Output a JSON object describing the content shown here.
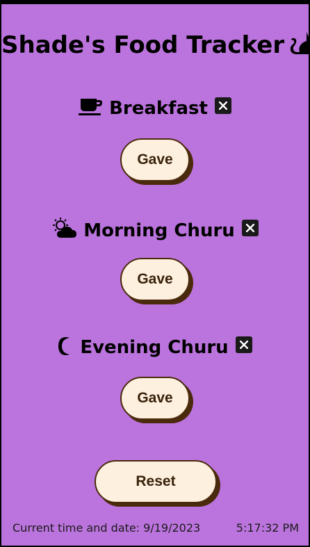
{
  "app": {
    "title": "Shade's Food Tracker"
  },
  "meals": [
    {
      "label": "Breakfast",
      "icon": "coffee-icon",
      "button_label": "Gave"
    },
    {
      "label": "Morning Churu",
      "icon": "sun-behind-cloud-icon",
      "button_label": "Gave"
    },
    {
      "label": "Evening Churu",
      "icon": "moon-icon",
      "button_label": "Gave"
    }
  ],
  "reset_label": "Reset",
  "footer": {
    "date_text": "Current time and date: 9/19/2023",
    "time_text": "5:17:32 PM"
  },
  "colors": {
    "background": "#bb74dd",
    "button_fill": "#fdf0df",
    "button_shadow": "#4a2a0c"
  }
}
